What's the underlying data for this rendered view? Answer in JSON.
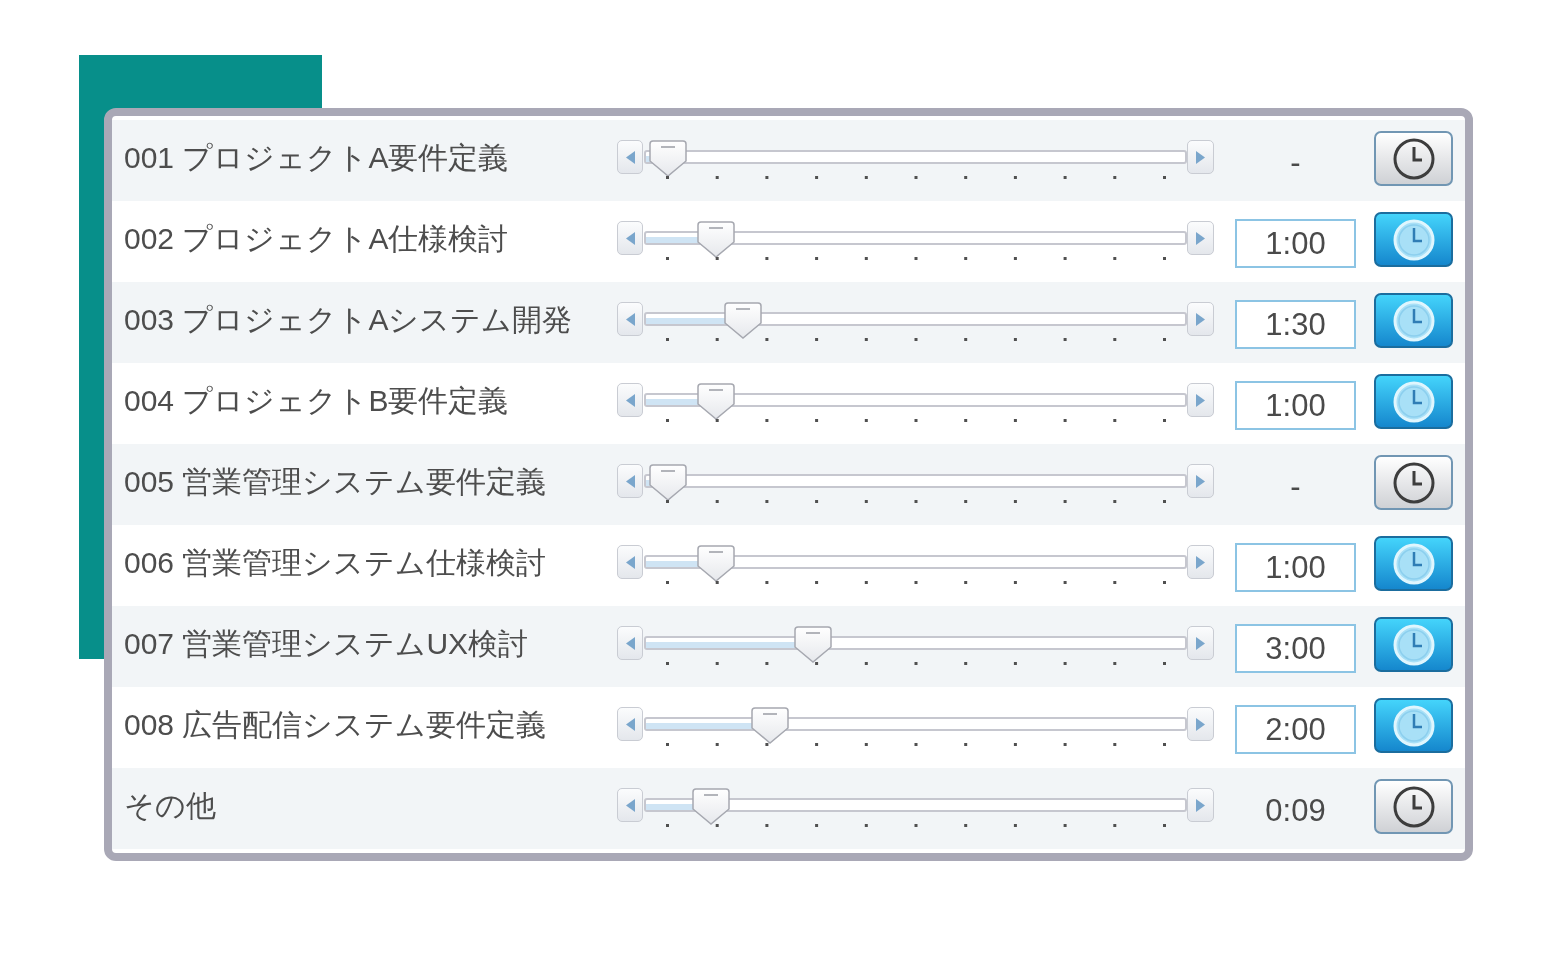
{
  "rows": [
    {
      "label": "001 プロジェクトA要件定義",
      "level": 0.04,
      "time": "-",
      "active": false
    },
    {
      "label": "002 プロジェクトA仕様検討",
      "level": 0.13,
      "time": "1:00",
      "active": true
    },
    {
      "label": "003 プロジェクトAシステム開発",
      "level": 0.18,
      "time": "1:30",
      "active": true
    },
    {
      "label": "004 プロジェクトB要件定義",
      "level": 0.13,
      "time": "1:00",
      "active": true
    },
    {
      "label": "005 営業管理システム要件定義",
      "level": 0.04,
      "time": "-",
      "active": false
    },
    {
      "label": "006 営業管理システム仕様検討",
      "level": 0.13,
      "time": "1:00",
      "active": true
    },
    {
      "label": "007 営業管理システムUX検討",
      "level": 0.31,
      "time": "3:00",
      "active": true
    },
    {
      "label": "008 広告配信システム要件定義",
      "level": 0.23,
      "time": "2:00",
      "active": true
    },
    {
      "label": "その他",
      "level": 0.12,
      "time": "0:09",
      "active": false
    }
  ]
}
